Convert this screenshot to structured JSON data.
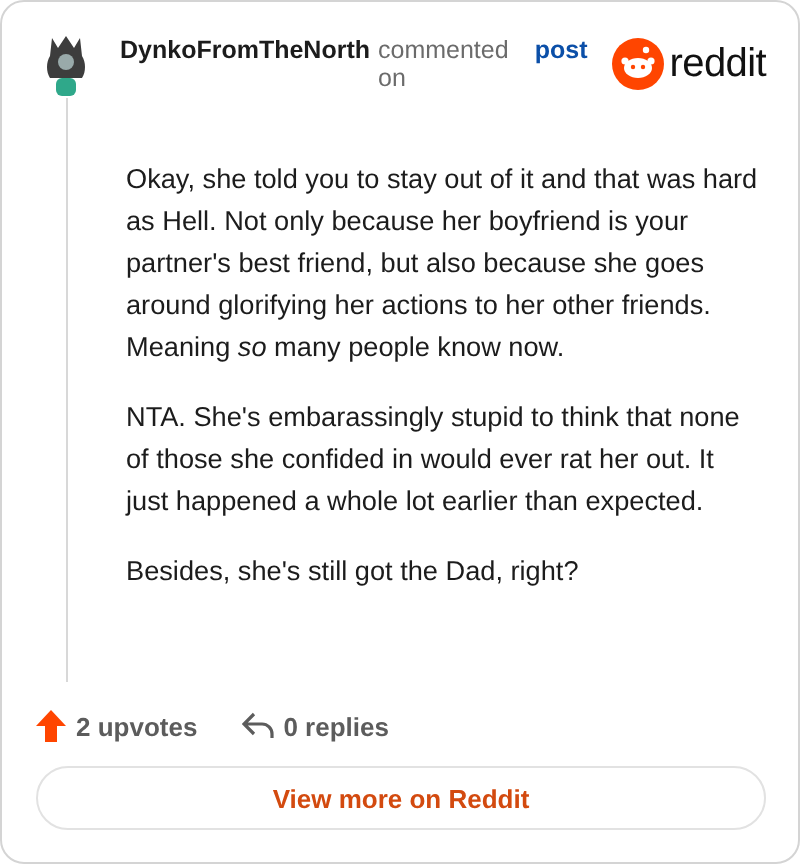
{
  "header": {
    "author": "DynkoFromTheNorth",
    "action": "commented on",
    "link": "post",
    "brand": "reddit"
  },
  "paragraphs": [
    "Okay, she told you to stay out of it and that was hard as Hell. Not only because her boyfriend is your partner's best friend, but also because she goes around glorifying her actions to her other friends. Meaning *so* many people know now.",
    "NTA. She's embarassingly stupid to think that none of those she confided in would ever rat her out. It just happened a whole lot earlier than expected.",
    "Besides, she's still got the Dad, right?"
  ],
  "footer": {
    "upvotes": "2 upvotes",
    "replies": "0 replies"
  },
  "button": "View more on Reddit"
}
